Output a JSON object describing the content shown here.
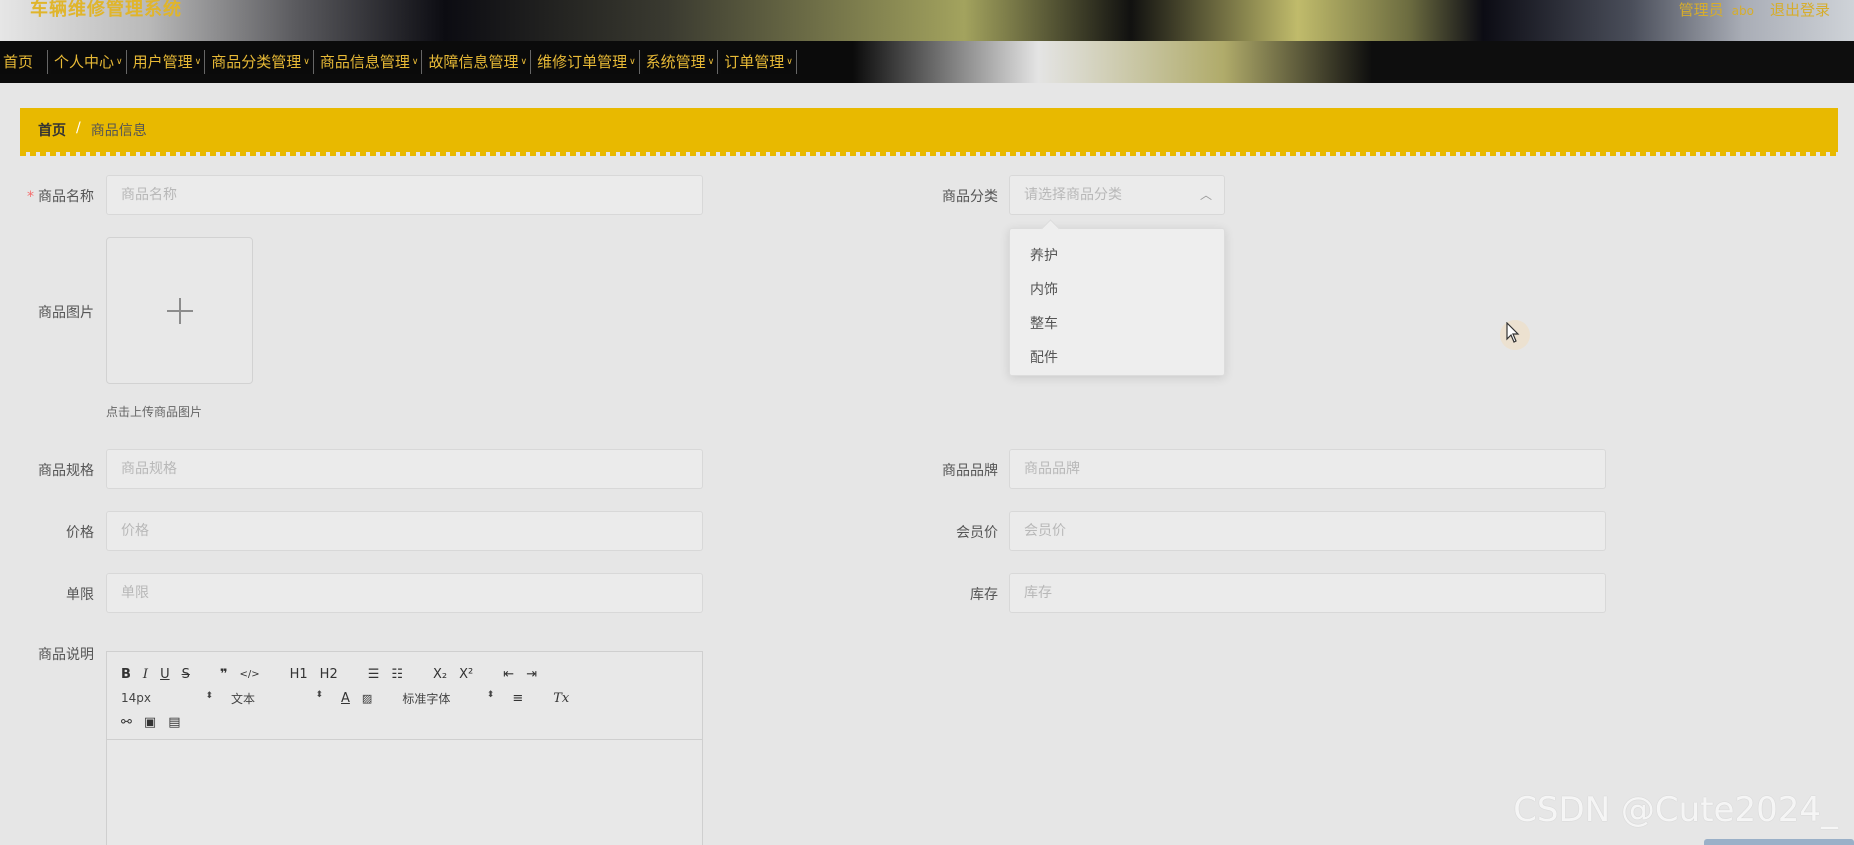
{
  "header": {
    "system_title": "车辆维修管理系统",
    "role": "管理员",
    "username": "abo",
    "logout": "退出登录"
  },
  "nav": {
    "items": [
      {
        "label": "首页",
        "has_menu": false
      },
      {
        "label": "个人中心",
        "has_menu": true
      },
      {
        "label": "用户管理",
        "has_menu": true
      },
      {
        "label": "商品分类管理",
        "has_menu": true
      },
      {
        "label": "商品信息管理",
        "has_menu": true
      },
      {
        "label": "故障信息管理",
        "has_menu": true
      },
      {
        "label": "维修订单管理",
        "has_menu": true
      },
      {
        "label": "系统管理",
        "has_menu": true
      },
      {
        "label": "订单管理",
        "has_menu": true
      }
    ]
  },
  "breadcrumb": {
    "home": "首页",
    "separator": "/",
    "current": "商品信息"
  },
  "form": {
    "name": {
      "label": "商品名称",
      "placeholder": "商品名称",
      "required_mark": "*"
    },
    "category": {
      "label": "商品分类",
      "placeholder": "请选择商品分类",
      "options": [
        "养护",
        "内饰",
        "整车",
        "配件"
      ]
    },
    "image": {
      "label": "商品图片",
      "tip": "点击上传商品图片"
    },
    "spec": {
      "label": "商品规格",
      "placeholder": "商品规格"
    },
    "brand": {
      "label": "商品品牌",
      "placeholder": "商品品牌"
    },
    "price": {
      "label": "价格",
      "placeholder": "价格"
    },
    "member_price": {
      "label": "会员价",
      "placeholder": "会员价"
    },
    "limit": {
      "label": "单限",
      "placeholder": "单限"
    },
    "stock": {
      "label": "库存",
      "placeholder": "库存"
    },
    "description": {
      "label": "商品说明",
      "toolbar": {
        "font_size": "14px",
        "paragraph": "文本",
        "font_family": "标准字体",
        "h1": "H1",
        "h2": "H2"
      }
    }
  },
  "watermark": "CSDN @Cute2024_"
}
